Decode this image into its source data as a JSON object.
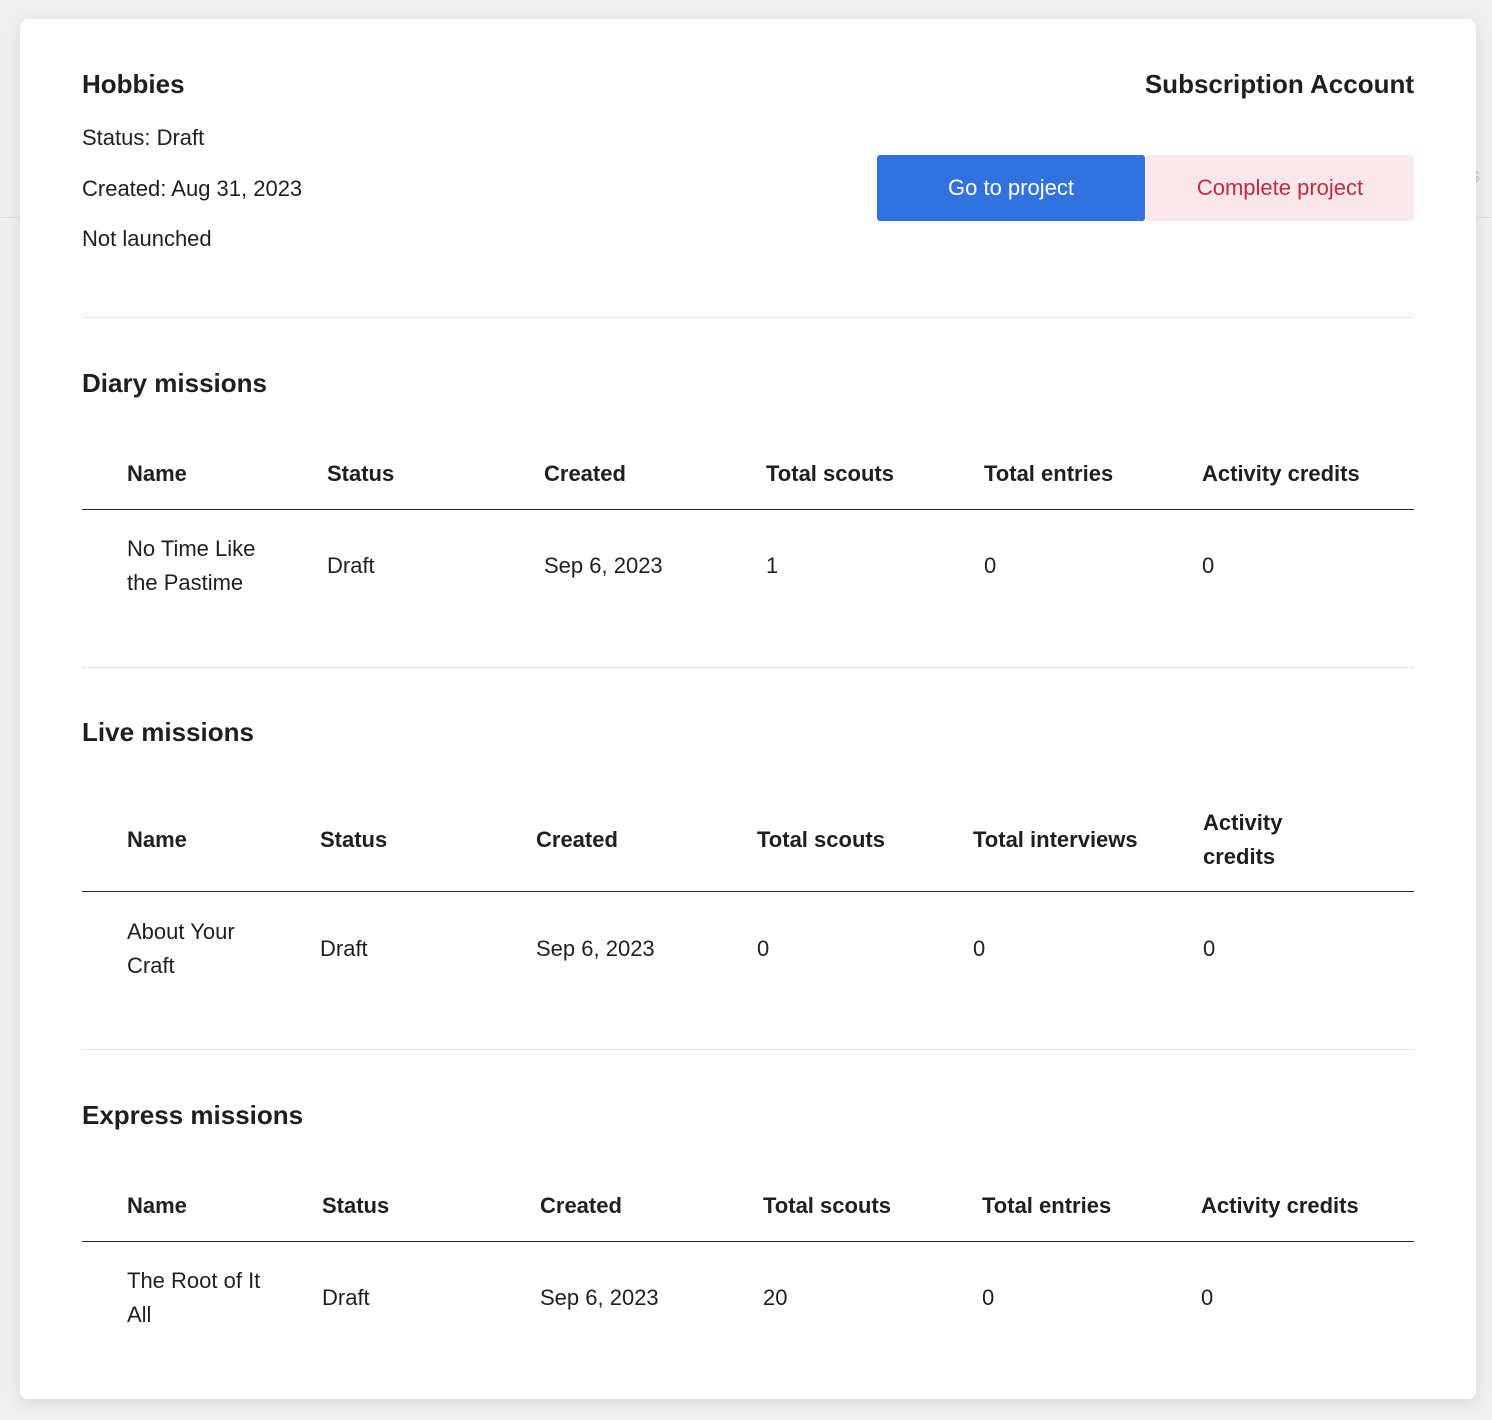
{
  "project": {
    "title": "Hobbies",
    "status_line": "Status: Draft",
    "created_line": "Created: Aug 31, 2023",
    "launch_state": "Not launched",
    "account": "Subscription Account",
    "go_button": "Go to project",
    "complete_button": "Complete project"
  },
  "sections": {
    "diary": {
      "title": "Diary missions",
      "headers": [
        "Name",
        "Status",
        "Created",
        "Total scouts",
        "Total entries",
        "Activity credits"
      ],
      "rows": [
        [
          "No Time Like the Pastime",
          "Draft",
          "Sep 6, 2023",
          "1",
          "0",
          "0"
        ]
      ]
    },
    "live": {
      "title": "Live missions",
      "headers": [
        "Name",
        "Status",
        "Created",
        "Total scouts",
        "Total interviews",
        "Activity credits"
      ],
      "rows": [
        [
          "About Your Craft",
          "Draft",
          "Sep 6, 2023",
          "0",
          "0",
          "0"
        ]
      ]
    },
    "express": {
      "title": "Express missions",
      "headers": [
        "Name",
        "Status",
        "Created",
        "Total scouts",
        "Total entries",
        "Activity credits"
      ],
      "rows": [
        [
          "The Root of It All",
          "Draft",
          "Sep 6, 2023",
          "20",
          "0",
          "0"
        ]
      ]
    }
  }
}
